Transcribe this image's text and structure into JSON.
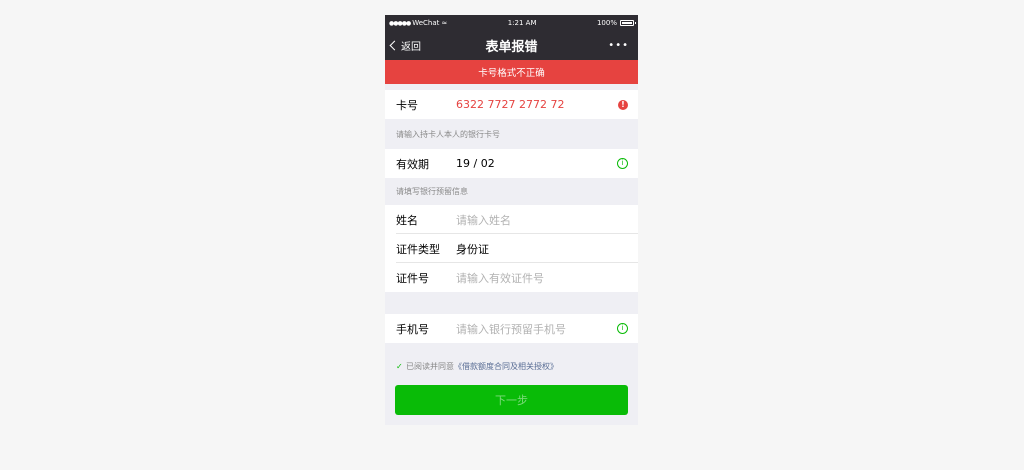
{
  "status": {
    "signal": "●●●●●",
    "carrier": "WeChat",
    "wifi": "≈",
    "time": "1:21 AM",
    "battery": "100%"
  },
  "nav": {
    "back_label": "返回",
    "title": "表单报错",
    "more": "•••"
  },
  "error_banner": "卡号格式不正确",
  "card": {
    "label": "卡号",
    "value": "6322 7727 2772 72",
    "error_icon": "!"
  },
  "card_hint": "请输入持卡人本人的银行卡号",
  "expiry": {
    "label": "有效期",
    "value": "19 / 02",
    "info_icon": "i"
  },
  "info_hint": "请填写银行预留信息",
  "name": {
    "label": "姓名",
    "placeholder": "请输入姓名"
  },
  "id_type": {
    "label": "证件类型",
    "value": "身份证"
  },
  "id_number": {
    "label": "证件号",
    "placeholder": "请输入有效证件号"
  },
  "phone": {
    "label": "手机号",
    "placeholder": "请输入银行预留手机号",
    "info_icon": "i"
  },
  "agreement": {
    "check": "✓",
    "text": "已阅读并同意",
    "link": "《借款额度合同及相关授权》"
  },
  "next_button": "下一步",
  "colors": {
    "nav_bg": "#2e2c32",
    "error": "#e64340",
    "primary": "#09bb07",
    "link": "#586c94"
  }
}
